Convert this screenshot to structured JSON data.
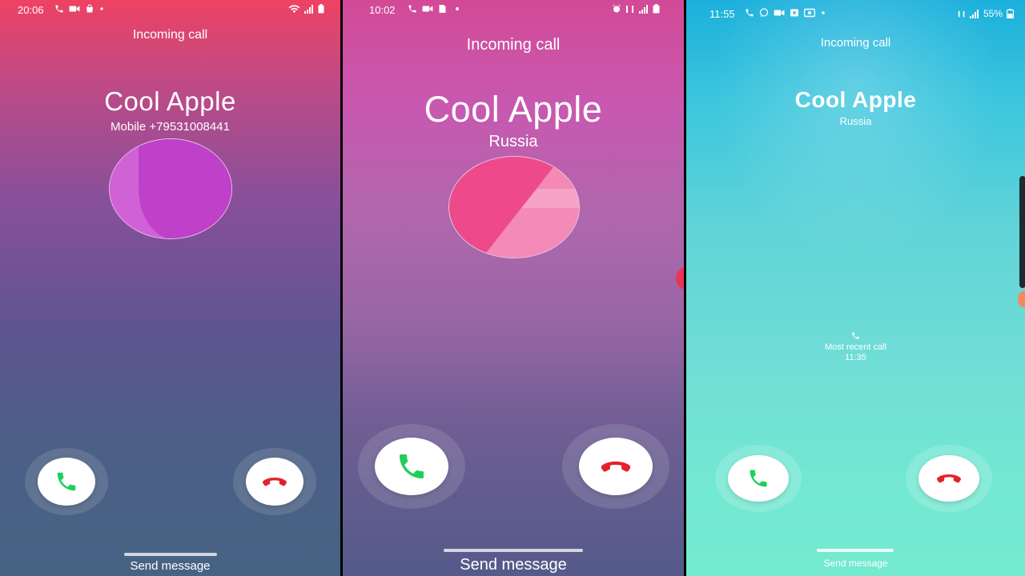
{
  "panels": [
    {
      "status": {
        "time": "20:06"
      },
      "incoming_label": "Incoming call",
      "caller_name": "Cool Apple",
      "caller_detail": "Mobile  +79531008441",
      "send_message": "Send message"
    },
    {
      "status": {
        "time": "10:02"
      },
      "incoming_label": "Incoming call",
      "caller_name": "Cool Apple",
      "caller_detail": "Russia",
      "send_message": "Send message"
    },
    {
      "status": {
        "time": "11:55",
        "battery": "55%"
      },
      "incoming_label": "Incoming call",
      "caller_name": "Cool Apple",
      "caller_detail": "Russia",
      "recent_label": "Most recent call",
      "recent_time": "11:35",
      "send_message": "Send message"
    }
  ],
  "icons": {
    "accept": "phone-accept-icon",
    "decline": "phone-decline-icon"
  },
  "colors": {
    "accept_green": "#1fcf5a",
    "decline_red": "#e3222b"
  }
}
